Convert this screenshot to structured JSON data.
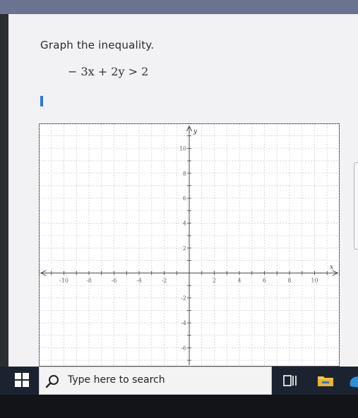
{
  "question": {
    "prompt": "Graph the inequality.",
    "inequality": "− 3x + 2y > 2"
  },
  "graph": {
    "x_axis_label": "x",
    "y_axis_label": "y",
    "x_range": [
      -12,
      12
    ],
    "y_range": [
      -7.5,
      12
    ],
    "x_tick_labels": [
      "-10",
      "-8",
      "-6",
      "-4",
      "-2",
      "2",
      "4",
      "6",
      "8",
      "10"
    ],
    "y_tick_labels": [
      "10",
      "8",
      "6",
      "4",
      "2",
      "-2",
      "-4",
      "-6"
    ],
    "grid_color": "#cfd2d6",
    "axis_color": "#444444"
  },
  "taskbar": {
    "search_placeholder": "Type here to search"
  },
  "colors": {
    "cursor": "#2a78d6",
    "taskbar": "#1c2330",
    "folder": "#f4c542",
    "edge": "#2a90d8"
  }
}
